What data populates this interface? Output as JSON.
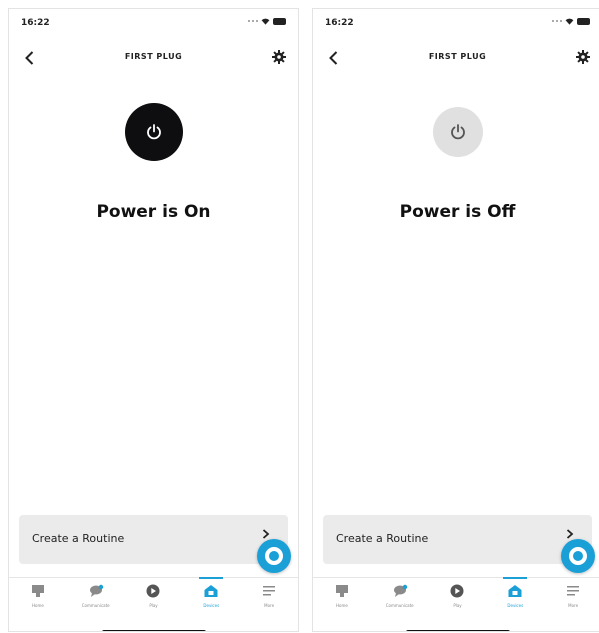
{
  "screens": [
    {
      "status_time": "16:22",
      "title": "FIRST PLUG",
      "power_status": "Power is On",
      "power_button_color": "#0e0e10",
      "routine_label": "Create a Routine",
      "tabs": [
        {
          "label": "Home",
          "icon": "home-icon"
        },
        {
          "label": "Communicate",
          "icon": "chat-icon"
        },
        {
          "label": "Play",
          "icon": "play-icon"
        },
        {
          "label": "Devices",
          "icon": "devices-icon",
          "active": true
        },
        {
          "label": "More",
          "icon": "menu-icon"
        }
      ]
    },
    {
      "status_time": "16:22",
      "title": "FIRST PLUG",
      "power_status": "Power is Off",
      "power_button_color": "#e0e0e0",
      "routine_label": "Create a Routine",
      "tabs": [
        {
          "label": "Home",
          "icon": "home-icon"
        },
        {
          "label": "Communicate",
          "icon": "chat-icon"
        },
        {
          "label": "Play",
          "icon": "play-icon"
        },
        {
          "label": "Devices",
          "icon": "devices-icon",
          "active": true
        },
        {
          "label": "More",
          "icon": "menu-icon"
        }
      ]
    }
  ],
  "colors": {
    "accent": "#1a9fd6",
    "card_bg": "#ebebeb"
  }
}
